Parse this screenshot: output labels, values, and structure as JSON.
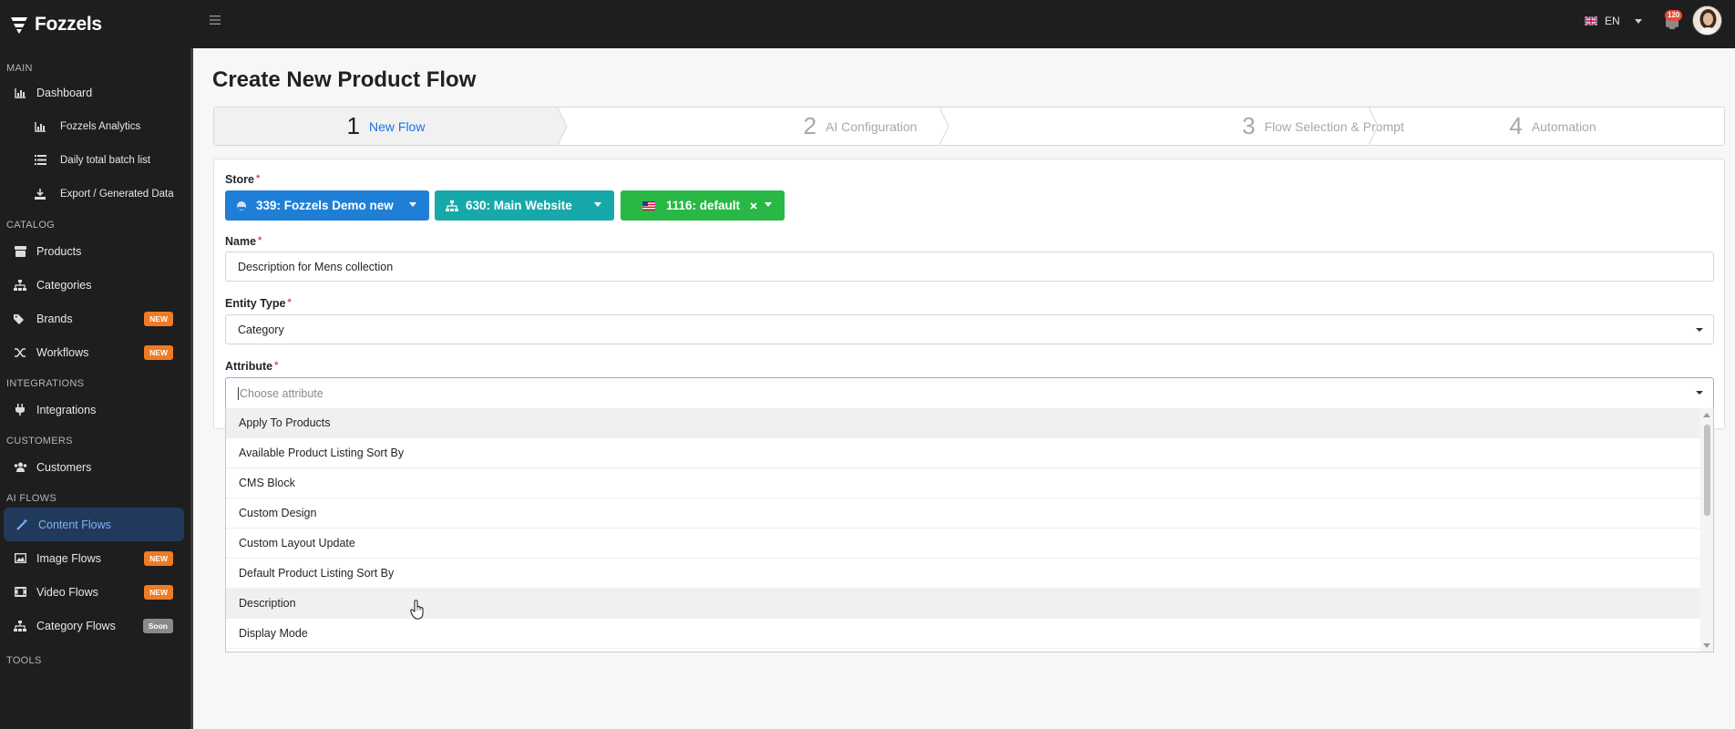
{
  "brand": {
    "name": "Fozzels"
  },
  "sidebar": {
    "sections": [
      {
        "title": "MAIN"
      },
      {
        "title": "CATALOG"
      },
      {
        "title": "INTEGRATIONS"
      },
      {
        "title": "CUSTOMERS"
      },
      {
        "title": "AI FLOWS"
      },
      {
        "title": "TOOLS"
      }
    ],
    "items": [
      {
        "label": "Dashboard",
        "icon": "chart-icon"
      },
      {
        "label": "Fozzels Analytics",
        "icon": "chart-icon"
      },
      {
        "label": "Daily total batch list",
        "icon": "list-icon"
      },
      {
        "label": "Export / Generated Data",
        "icon": "download-icon"
      },
      {
        "label": "Products",
        "icon": "box-icon"
      },
      {
        "label": "Categories",
        "icon": "sitemap-icon"
      },
      {
        "label": "Brands",
        "icon": "tags-icon",
        "badge": "NEW"
      },
      {
        "label": "Workflows",
        "icon": "shuffle-icon",
        "badge": "NEW"
      },
      {
        "label": "Integrations",
        "icon": "plug-icon"
      },
      {
        "label": "Customers",
        "icon": "users-icon"
      },
      {
        "label": "Content Flows",
        "icon": "wand-icon"
      },
      {
        "label": "Image Flows",
        "icon": "image-icon",
        "badge": "NEW"
      },
      {
        "label": "Video Flows",
        "icon": "film-icon",
        "badge": "NEW"
      },
      {
        "label": "Category Flows",
        "icon": "sitemap-icon",
        "badge": "Soon"
      }
    ]
  },
  "topbar": {
    "language": "EN",
    "notifications": "120"
  },
  "page": {
    "title": "Create New Product Flow"
  },
  "steps": [
    {
      "num": "1",
      "label": "New Flow"
    },
    {
      "num": "2",
      "label": "AI Configuration"
    },
    {
      "num": "3",
      "label": "Flow Selection & Prompt"
    },
    {
      "num": "4",
      "label": "Automation"
    }
  ],
  "form": {
    "store": {
      "label": "Store",
      "required": "*",
      "store_button": "339: Fozzels Demo new",
      "website_button": "630: Main Website",
      "view_button": "1116: default"
    },
    "name": {
      "label": "Name",
      "required": "*",
      "value": "Description for Mens collection"
    },
    "entity_type": {
      "label": "Entity Type",
      "required": "*",
      "value": "Category"
    },
    "attribute": {
      "label": "Attribute",
      "required": "*",
      "placeholder": "Choose attribute",
      "options": [
        "Apply To Products",
        "Available Product Listing Sort By",
        "CMS Block",
        "Custom Design",
        "Custom Layout Update",
        "Default Product Listing Sort By",
        "Description",
        "Display Mode"
      ]
    }
  },
  "colors": {
    "sidebar_bg": "#1e1e1e",
    "active_item": "#213a5c",
    "accent": "#1a73e8",
    "badge_new": "#f07b24",
    "store_blue": "#1f7fd6",
    "website_teal": "#17a9a9",
    "view_green": "#29b845"
  }
}
